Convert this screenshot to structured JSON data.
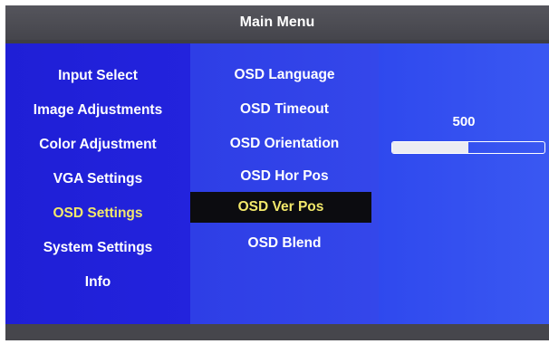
{
  "title": "Main Menu",
  "categories": [
    {
      "label": "Input Select"
    },
    {
      "label": "Image Adjustments"
    },
    {
      "label": "Color Adjustment"
    },
    {
      "label": "VGA Settings"
    },
    {
      "label": "OSD Settings"
    },
    {
      "label": "System Settings"
    },
    {
      "label": "Info"
    }
  ],
  "active_category": "OSD Settings",
  "submenu": [
    {
      "label": "OSD Language"
    },
    {
      "label": "OSD Timeout"
    },
    {
      "label": "OSD Orientation"
    },
    {
      "label": "OSD Hor Pos"
    },
    {
      "label": "OSD Ver Pos"
    },
    {
      "label": "OSD Blend"
    }
  ],
  "selected_submenu": "OSD Ver Pos",
  "value": {
    "label": "500",
    "fill_fraction": 0.5
  },
  "colors": {
    "highlight_text": "#f2e86a",
    "selection_bg": "#0c0c10",
    "normal_text": "#ffffff"
  }
}
